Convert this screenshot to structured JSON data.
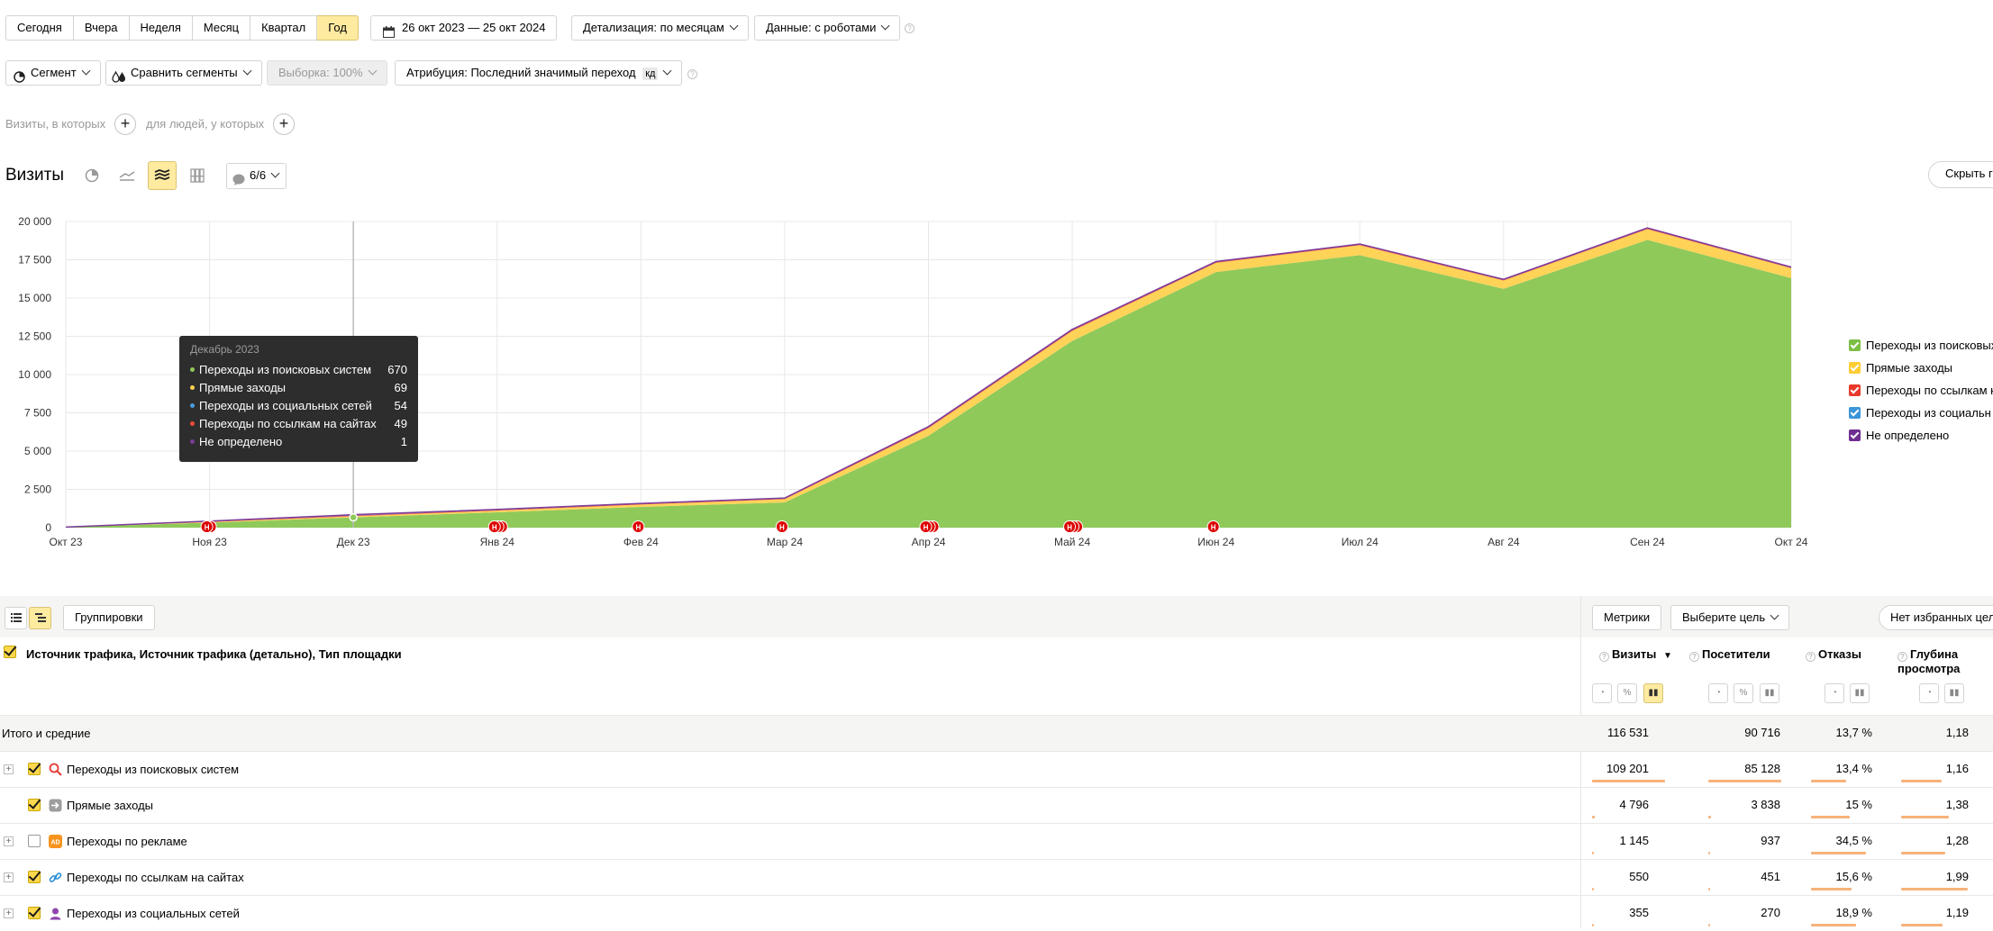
{
  "periods": [
    "Сегодня",
    "Вчера",
    "Неделя",
    "Месяц",
    "Квартал",
    "Год"
  ],
  "active_period": "Год",
  "date_range": "26 окт 2023 — 25 окт 2024",
  "detail": "Детализация: по месяцам",
  "data_mode": "Данные: с роботами",
  "segment": "Сегмент",
  "compare": "Сравнить сегменты",
  "sample": "Выборка: 100%",
  "attribution": "Атрибуция: Последний значимый переход",
  "attribution_badge": "кд",
  "filter_visits": "Визиты, в которых",
  "filter_people": "для людей, у которых",
  "chart_title": "Визиты",
  "series_toggle": "6/6",
  "hide_chart": "Скрыть гр",
  "chart_data": {
    "type": "area",
    "stacked": true,
    "x": [
      "Окт 23",
      "Ноя 23",
      "Дек 23",
      "Янв 24",
      "Фев 24",
      "Мар 24",
      "Апр 24",
      "Май 24",
      "Июн 24",
      "Июл 24",
      "Авг 24",
      "Сен 24",
      "Окт 24"
    ],
    "ylim": [
      0,
      20000
    ],
    "yticks": [
      "0",
      "2 500",
      "5 000",
      "7 500",
      "10 000",
      "12 500",
      "15 000",
      "17 500",
      "20 000"
    ],
    "grid": true,
    "legend_position": "right",
    "series": [
      {
        "name": "Переходы из поисковых систем",
        "color": "#8fc95a",
        "values": [
          30,
          330,
          670,
          1000,
          1350,
          1650,
          6000,
          12200,
          16700,
          17800,
          15600,
          18800,
          16300
        ]
      },
      {
        "name": "Прямые заходы",
        "color": "#ffd14f",
        "values": [
          4,
          40,
          69,
          110,
          160,
          210,
          500,
          650,
          600,
          650,
          550,
          700,
          650
        ]
      },
      {
        "name": "Переходы по ссылкам на сайтах",
        "color": "#f04b3a",
        "values": [
          2,
          25,
          49,
          40,
          40,
          40,
          60,
          60,
          50,
          50,
          40,
          50,
          40
        ]
      },
      {
        "name": "Переходы из социальных сетей",
        "color": "#4a9fdf",
        "values": [
          2,
          30,
          54,
          40,
          30,
          30,
          40,
          40,
          30,
          30,
          30,
          30,
          30
        ]
      },
      {
        "name": "Не определено",
        "color": "#7a3c9a",
        "values": [
          0,
          1,
          1,
          1,
          1,
          1,
          1,
          1,
          1,
          1,
          1,
          1,
          1
        ]
      }
    ]
  },
  "tooltip": {
    "title": "Декабрь 2023",
    "rows": [
      {
        "name": "Переходы из поисковых систем",
        "value": "670",
        "color": "#8fc95a"
      },
      {
        "name": "Прямые заходы",
        "value": "69",
        "color": "#ffd14f"
      },
      {
        "name": "Переходы из социальных сетей",
        "value": "54",
        "color": "#4a9fdf"
      },
      {
        "name": "Переходы по ссылкам на сайтах",
        "value": "49",
        "color": "#f04b3a"
      },
      {
        "name": "Не определено",
        "value": "1",
        "color": "#7a3c9a"
      }
    ]
  },
  "legend": [
    {
      "name": "Переходы из поисковых",
      "color": "#7cbf45"
    },
    {
      "name": "Прямые заходы",
      "color": "#ffcc33"
    },
    {
      "name": "Переходы по ссылкам н",
      "color": "#e8392b"
    },
    {
      "name": "Переходы из социальн",
      "color": "#3b95d9"
    },
    {
      "name": "Не определено",
      "color": "#6f2d91"
    }
  ],
  "markers": [
    {
      "month": 1,
      "label": "Н",
      "count": 2
    },
    {
      "month": 3,
      "label": "Н",
      "count": 3
    },
    {
      "month": 4,
      "label": "Н",
      "count": 1
    },
    {
      "month": 5,
      "label": "Н",
      "count": 1
    },
    {
      "month": 6,
      "label": "Н",
      "count": 3
    },
    {
      "month": 7,
      "label": "Н",
      "count": 3
    },
    {
      "month": 8,
      "label": "Н",
      "count": 1
    }
  ],
  "table": {
    "groupings": "Группировки",
    "metrics": "Метрики",
    "goal": "Выберите цель",
    "favorites": "Нет избранных цел",
    "dimensions": "Источник трафика, Источник трафика (детально), Тип площадки",
    "columns": [
      "Визиты",
      "Посетители",
      "Отказы",
      "Глубина просмотра"
    ],
    "sort_indicator": "▼",
    "totals_label": "Итого и средние",
    "totals": [
      "116 531",
      "90 716",
      "13,7 %",
      "1,18"
    ],
    "rows": [
      {
        "name": "Переходы из поисковых систем",
        "checked": true,
        "expand": true,
        "icon": "search",
        "values": [
          "109 201",
          "85 128",
          "13,4 %",
          "1,16"
        ],
        "fill": [
          0.937,
          0.938,
          0.54,
          0.55
        ]
      },
      {
        "name": "Прямые заходы",
        "checked": true,
        "expand": false,
        "icon": "direct",
        "values": [
          "4 796",
          "3 838",
          "15 %",
          "1,38"
        ],
        "fill": [
          0.04,
          0.04,
          0.6,
          0.65
        ]
      },
      {
        "name": "Переходы по рекламе",
        "checked": false,
        "expand": true,
        "icon": "ad",
        "values": [
          "1 145",
          "937",
          "34,5 %",
          "1,28"
        ],
        "fill": [
          0.01,
          0.01,
          0.85,
          0.6
        ]
      },
      {
        "name": "Переходы по ссылкам на сайтах",
        "checked": true,
        "expand": true,
        "icon": "link",
        "values": [
          "550",
          "451",
          "15,6 %",
          "1,99"
        ],
        "fill": [
          0.005,
          0.005,
          0.62,
          0.9
        ]
      },
      {
        "name": "Переходы из социальных сетей",
        "checked": true,
        "expand": true,
        "icon": "social",
        "values": [
          "355",
          "270",
          "18,9 %",
          "1,19"
        ],
        "fill": [
          0.003,
          0.003,
          0.7,
          0.56
        ]
      }
    ]
  }
}
